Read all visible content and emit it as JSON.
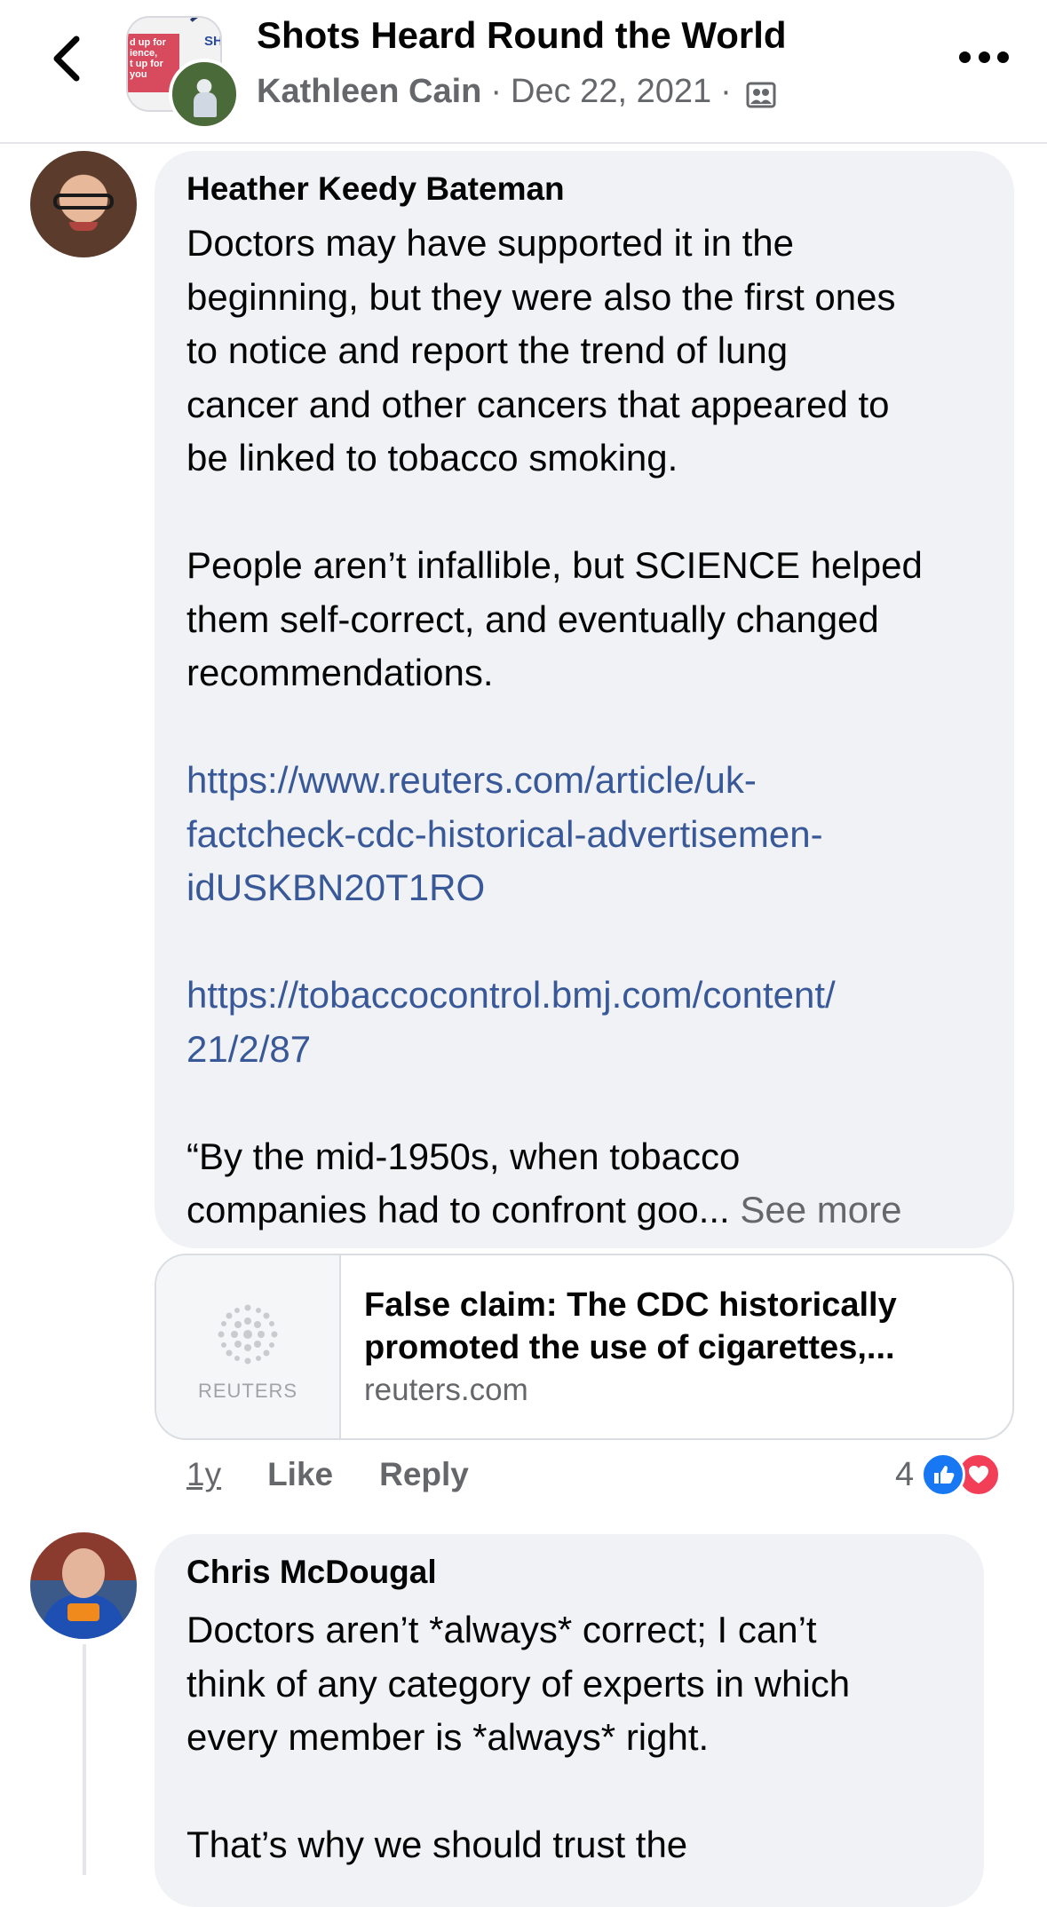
{
  "header": {
    "title": "Shots Heard Round the World",
    "author": "Kathleen Cain",
    "separator": "·",
    "date": "Dec 22, 2021",
    "group_photo_text": "d up for\nience,\nt up for you",
    "group_photo_text_right": "SH"
  },
  "comments": [
    {
      "name": "Heather Keedy Bateman",
      "lines": [
        "Doctors may have supported it in the",
        "beginning, but they were also the first ones",
        "to notice and report the trend of lung",
        "cancer and other cancers that appeared to",
        "be linked to tobacco smoking.",
        "People aren’t infallible, but SCIENCE helped",
        "them self-correct, and eventually changed",
        "recommendations.",
        "https://www.reuters.com/article/uk-",
        "factcheck-cdc-historical-advertisemen-",
        "idUSKBN20T1RO",
        "https://tobaccocontrol.bmj.com/content/",
        "21/2/87",
        "“By the mid-1950s, when tobacco",
        "companies had to confront goo..."
      ],
      "see_more": "See more",
      "link_preview": {
        "source_logo_text": "REUTERS",
        "title_line1": "False claim: The CDC historically",
        "title_line2": "promoted the use of cigarettes,...",
        "domain": "reuters.com"
      },
      "time": "1y",
      "like_label": "Like",
      "reply_label": "Reply",
      "reaction_count": "4"
    },
    {
      "name": "Chris McDougal",
      "lines": [
        "Doctors aren’t *always* correct; I can’t",
        "think of any category of experts in which",
        "every member is *always* right.",
        "That’s why we should trust the"
      ]
    }
  ],
  "colors": {
    "bubble": "#f0f2f5",
    "link": "#385898",
    "secondary_text": "#65676b",
    "like_blue": "#1877f2",
    "love_red": "#f33e58"
  },
  "icons": [
    "back-chevron-icon",
    "group-audience-icon",
    "more-options-icon",
    "like-reaction-icon",
    "love-reaction-icon",
    "reuters-logo-icon"
  ]
}
